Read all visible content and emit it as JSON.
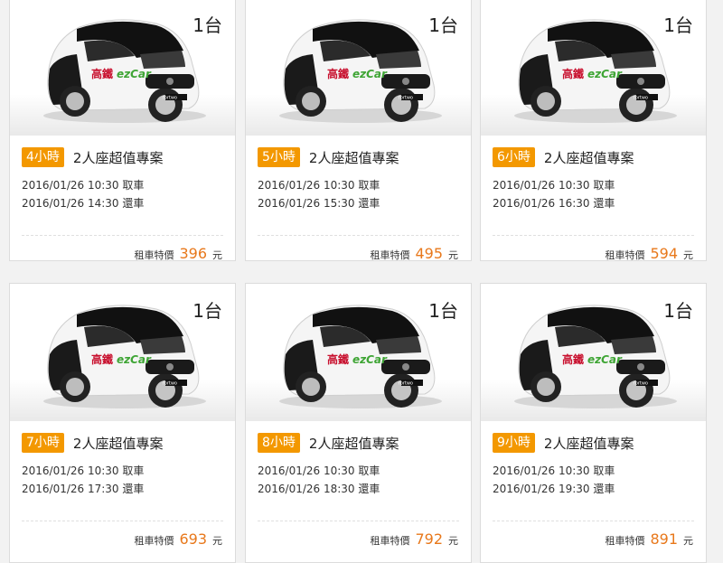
{
  "accent": "#f39800",
  "price_color": "#e8781b",
  "cards": [
    {
      "qty": "1台",
      "hours": "4小時",
      "plan": "2人座超值專案",
      "pickup": "2016/01/26 10:30 取車",
      "return": "2016/01/26 14:30 還車",
      "price_label": "租車特價",
      "price": "396",
      "unit": "元"
    },
    {
      "qty": "1台",
      "hours": "5小時",
      "plan": "2人座超值專案",
      "pickup": "2016/01/26 10:30 取車",
      "return": "2016/01/26 15:30 還車",
      "price_label": "租車特價",
      "price": "495",
      "unit": "元"
    },
    {
      "qty": "1台",
      "hours": "6小時",
      "plan": "2人座超值專案",
      "pickup": "2016/01/26 10:30 取車",
      "return": "2016/01/26 16:30 還車",
      "price_label": "租車特價",
      "price": "594",
      "unit": "元"
    },
    {
      "qty": "1台",
      "hours": "7小時",
      "plan": "2人座超值專案",
      "pickup": "2016/01/26 10:30 取車",
      "return": "2016/01/26 17:30 還車",
      "price_label": "租車特價",
      "price": "693",
      "unit": "元"
    },
    {
      "qty": "1台",
      "hours": "8小時",
      "plan": "2人座超值專案",
      "pickup": "2016/01/26 10:30 取車",
      "return": "2016/01/26 18:30 還車",
      "price_label": "租車特價",
      "price": "792",
      "unit": "元"
    },
    {
      "qty": "1台",
      "hours": "9小時",
      "plan": "2人座超值專案",
      "pickup": "2016/01/26 10:30 取車",
      "return": "2016/01/26 19:30 還車",
      "price_label": "租車特價",
      "price": "891",
      "unit": "元"
    }
  ],
  "car_image": {
    "icon": "smart-fortwo-car-image",
    "logo_text": "高鐵 ezCar",
    "model_badge": "fortwo"
  }
}
